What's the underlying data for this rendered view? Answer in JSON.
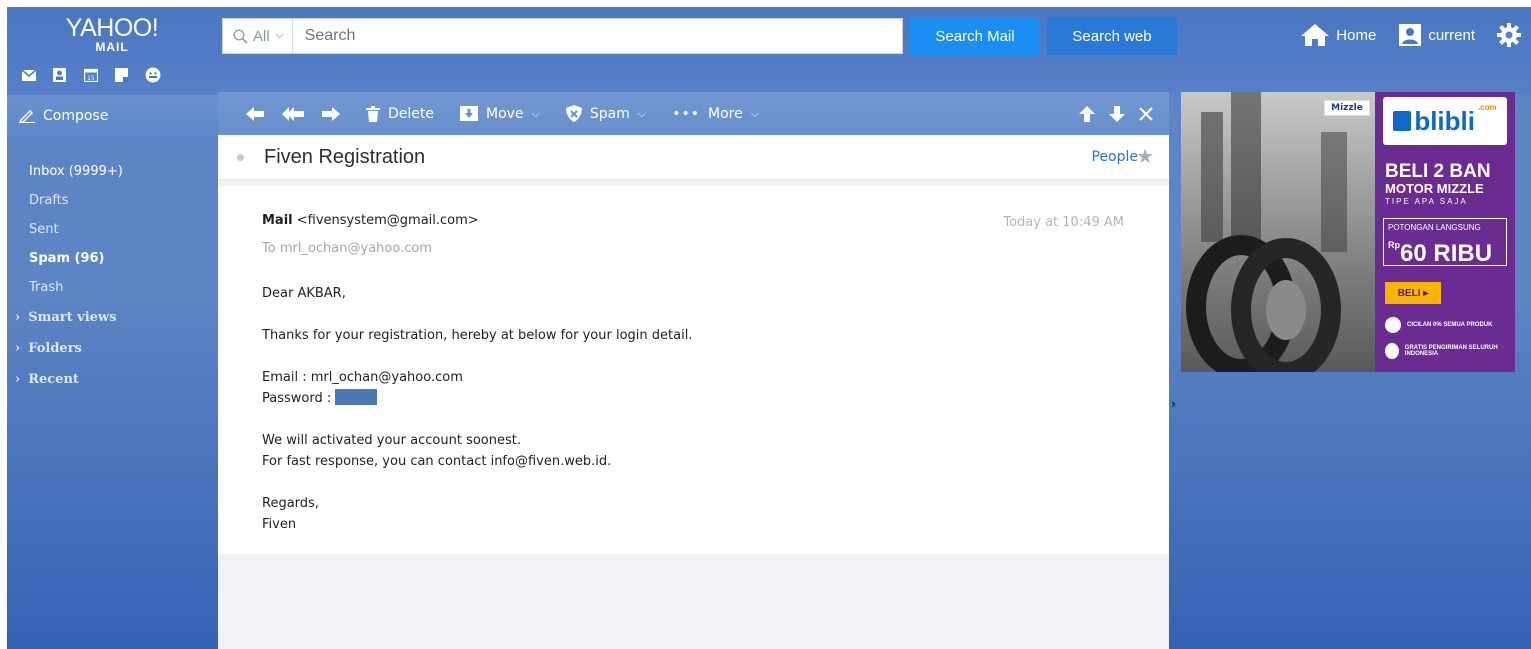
{
  "logo": {
    "brand": "YAHOO!",
    "sub": "MAIL"
  },
  "quick_icons": [
    "mail-icon",
    "contacts-icon",
    "calendar-icon",
    "notepad-icon",
    "messenger-icon"
  ],
  "calendar_day": "15",
  "search": {
    "scope": "All",
    "placeholder": "Search",
    "mail_button": "Search Mail",
    "web_button": "Search web"
  },
  "header": {
    "home": "Home",
    "account": "current"
  },
  "sidebar": {
    "compose": "Compose",
    "folders": [
      {
        "label": "Inbox (9999+)"
      },
      {
        "label": "Drafts"
      },
      {
        "label": "Sent"
      },
      {
        "label": "Spam (96)"
      },
      {
        "label": "Trash"
      }
    ],
    "sections": [
      "Smart views",
      "Folders",
      "Recent"
    ]
  },
  "toolbar": {
    "delete": "Delete",
    "move": "Move",
    "spam": "Spam",
    "more": "More"
  },
  "message": {
    "subject": "Fiven Registration",
    "people": "People",
    "from_name": "Mail",
    "from_email": "<fivensystem@gmail.com>",
    "to_label": "To",
    "to": "mrl_ochan@yahoo.com",
    "date": "Today at 10:49 AM",
    "greeting": "Dear AKBAR,",
    "line1": "Thanks for your registration, hereby at below for your login detail.",
    "email_line": "Email : mrl_ochan@yahoo.com",
    "password_label": "Password :",
    "line2": "We will activated your account soonest.",
    "line3": "For fast response, you can contact info@fiven.web.id.",
    "regards": "Regards,",
    "signature": "Fiven"
  },
  "ad": {
    "brand": "blibli",
    "brand_suffix": ".com",
    "sponsor": "Mizzle",
    "headline": "BELI 2 BAN",
    "sub": "MOTOR MIZZLE",
    "tipe": "TIPE APA SAJA",
    "potongan": "POTONGAN LANGSUNG",
    "rp": "Rp",
    "amount": "60 RIBU",
    "cta": "BELI",
    "note1": "CICILAN 0% SEMUA PRODUK",
    "note2": "GRATIS PENGIRIMAN SELURUH INDONESIA"
  },
  "colors": {
    "accent": "#1a8ef2",
    "link": "#2a72d4",
    "ad_purple": "#6a2c91"
  }
}
